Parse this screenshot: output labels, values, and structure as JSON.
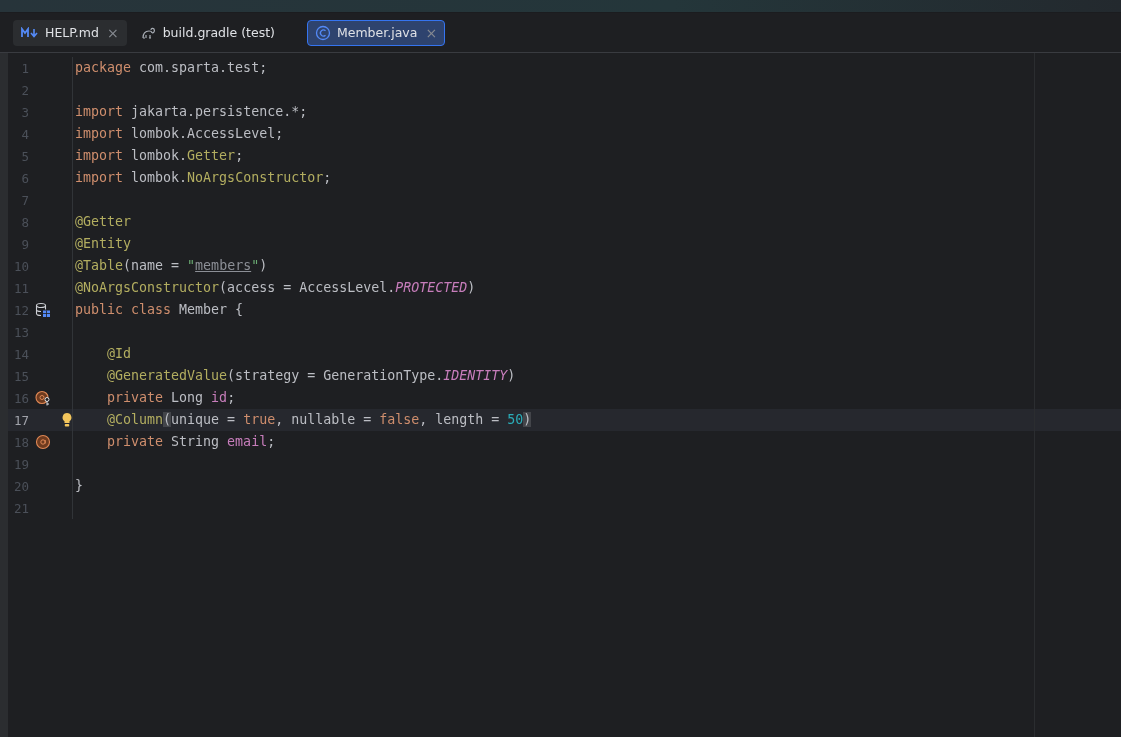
{
  "tabs": [
    {
      "label": "HELP.md",
      "closable": true,
      "selected": false
    },
    {
      "label": "build.gradle (test)",
      "closable": false,
      "selected": false
    },
    {
      "label": "Member.java",
      "closable": true,
      "selected": true
    }
  ],
  "close_glyph": "×",
  "editor": {
    "lines": [
      {
        "number": "1",
        "tokens": [
          {
            "kind": "keyword",
            "text": "package"
          },
          {
            "kind": "plain",
            "text": " com.sparta.test;"
          }
        ]
      },
      {
        "number": "2"
      },
      {
        "number": "3",
        "tokens": [
          {
            "kind": "keyword",
            "text": "import"
          },
          {
            "kind": "plain",
            "text": " jakarta.persistence.*;"
          }
        ]
      },
      {
        "number": "4",
        "tokens": [
          {
            "kind": "keyword",
            "text": "import"
          },
          {
            "kind": "plain",
            "text": " lombok.AccessLevel;"
          }
        ]
      },
      {
        "number": "5",
        "tokens": [
          {
            "kind": "keyword",
            "text": "import"
          },
          {
            "kind": "plain",
            "text": " lombok."
          },
          {
            "kind": "annotation",
            "text": "Getter"
          },
          {
            "kind": "plain",
            "text": ";"
          }
        ]
      },
      {
        "number": "6",
        "tokens": [
          {
            "kind": "keyword",
            "text": "import"
          },
          {
            "kind": "plain",
            "text": " lombok."
          },
          {
            "kind": "annotation",
            "text": "NoArgsConstructor"
          },
          {
            "kind": "plain",
            "text": ";"
          }
        ]
      },
      {
        "number": "7"
      },
      {
        "number": "8",
        "tokens": [
          {
            "kind": "annotation",
            "text": "@Getter"
          }
        ]
      },
      {
        "number": "9",
        "tokens": [
          {
            "kind": "annotation",
            "text": "@Entity"
          }
        ]
      },
      {
        "number": "10",
        "tokens": [
          {
            "kind": "annotation",
            "text": "@Table"
          },
          {
            "kind": "plain",
            "text": "(name = "
          },
          {
            "kind": "string",
            "text": "\""
          },
          {
            "kind": "reference",
            "text": "members"
          },
          {
            "kind": "string",
            "text": "\""
          },
          {
            "kind": "plain",
            "text": ")"
          }
        ]
      },
      {
        "number": "11",
        "tokens": [
          {
            "kind": "annotation",
            "text": "@NoArgsConstructor"
          },
          {
            "kind": "plain",
            "text": "(access = AccessLevel."
          },
          {
            "kind": "constant",
            "text": "PROTECTED"
          },
          {
            "kind": "plain",
            "text": ")"
          }
        ]
      },
      {
        "number": "12",
        "kind": "entity",
        "tokens": [
          {
            "kind": "keyword",
            "text": "public class"
          },
          {
            "kind": "plain",
            "text": " Member {"
          }
        ]
      },
      {
        "number": "13"
      },
      {
        "number": "14",
        "tokens": [
          {
            "kind": "annotation",
            "text": "    @Id"
          }
        ]
      },
      {
        "number": "15",
        "tokens": [
          {
            "kind": "annotation",
            "text": "    @GeneratedValue"
          },
          {
            "kind": "plain",
            "text": "(strategy = GenerationType."
          },
          {
            "kind": "constant",
            "text": "IDENTITY"
          },
          {
            "kind": "plain",
            "text": ")"
          }
        ]
      },
      {
        "number": "16",
        "kind": "key",
        "tokens": [
          {
            "kind": "keyword",
            "text": "    private"
          },
          {
            "kind": "plain",
            "text": " Long "
          },
          {
            "kind": "field",
            "text": "id"
          },
          {
            "kind": "plain",
            "text": ";"
          }
        ]
      },
      {
        "number": "17",
        "current": true,
        "bulb": true,
        "tokens": [
          {
            "kind": "annotation",
            "text": "    @Column"
          },
          {
            "kind": "bracket",
            "text": "("
          },
          {
            "kind": "plain",
            "text": "unique = "
          },
          {
            "kind": "keyword",
            "text": "true"
          },
          {
            "kind": "plain",
            "text": ", nullable = "
          },
          {
            "kind": "keyword",
            "text": "false"
          },
          {
            "kind": "plain",
            "text": ", length = "
          },
          {
            "kind": "number",
            "text": "50"
          },
          {
            "kind": "bracket",
            "text": ")"
          }
        ]
      },
      {
        "number": "18",
        "kind": "field",
        "tokens": [
          {
            "kind": "keyword",
            "text": "    private"
          },
          {
            "kind": "plain",
            "text": " String "
          },
          {
            "kind": "field",
            "text": "email"
          },
          {
            "kind": "plain",
            "text": ";"
          }
        ]
      },
      {
        "number": "19"
      },
      {
        "number": "20",
        "tokens": [
          {
            "kind": "plain",
            "text": "}"
          }
        ]
      },
      {
        "number": "21"
      }
    ]
  }
}
